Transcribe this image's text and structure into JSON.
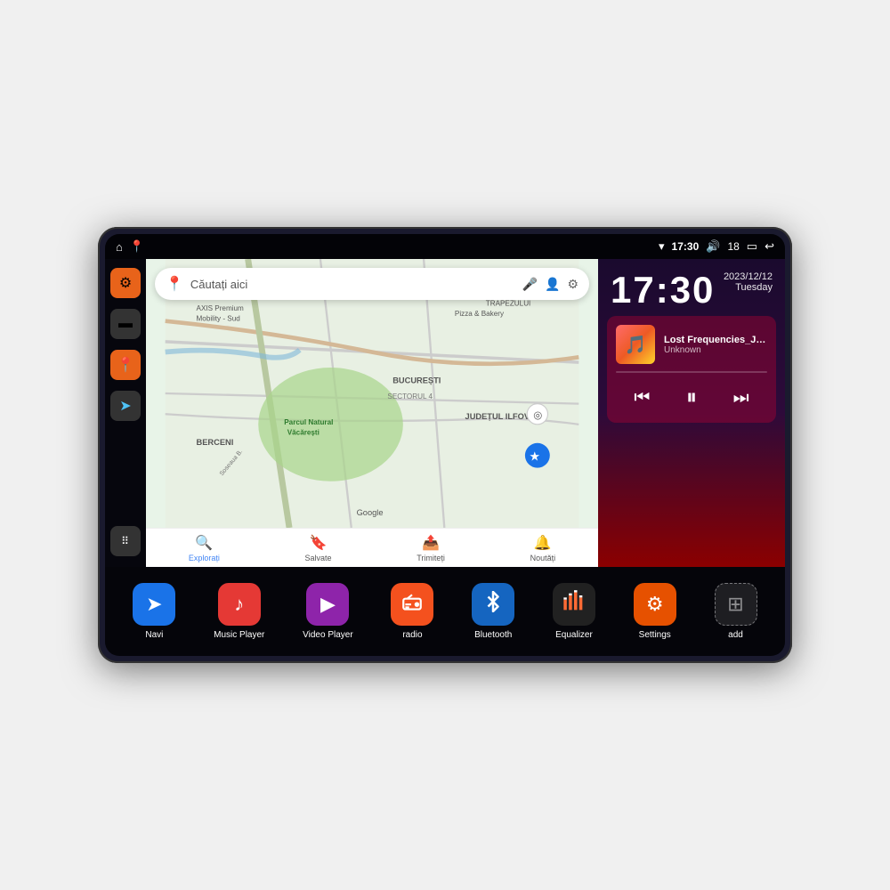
{
  "device": {
    "status_bar": {
      "wifi_icon": "▾",
      "time": "17:30",
      "volume_icon": "🔊",
      "battery_number": "18",
      "battery_icon": "🔋",
      "back_icon": "↩",
      "home_icon": "⌂",
      "maps_icon": "📍"
    },
    "left_sidebar": {
      "items": [
        {
          "id": "settings",
          "icon": "⚙",
          "style": "orange"
        },
        {
          "id": "files",
          "icon": "📁",
          "style": "dark"
        },
        {
          "id": "location",
          "icon": "📍",
          "style": "orange"
        },
        {
          "id": "navigation",
          "icon": "➤",
          "style": "dark"
        },
        {
          "id": "apps",
          "icon": "⋮⋮⋮",
          "style": "grid"
        }
      ]
    },
    "map": {
      "search_placeholder": "Căutați aici",
      "bottom_items": [
        {
          "id": "explore",
          "label": "Explorați",
          "icon": "🔍",
          "active": true
        },
        {
          "id": "saved",
          "label": "Salvate",
          "icon": "🔖",
          "active": false
        },
        {
          "id": "contribute",
          "label": "Trimiteți",
          "icon": "📤",
          "active": false
        },
        {
          "id": "news",
          "label": "Noutăți",
          "icon": "🔔",
          "active": false
        }
      ],
      "locations": [
        "AXIS Premium Mobility - Sud",
        "Parcul Natural Văcărești",
        "Pizza & Bakery",
        "BUCUREȘTI",
        "SECTORUL 4",
        "BERCENI",
        "JUDEȚUL ILFOV",
        "TRAPEZULUI"
      ]
    },
    "clock": {
      "time": "17:30",
      "date": "2023/12/12",
      "day": "Tuesday"
    },
    "music_player": {
      "title": "Lost Frequencies_Janie...",
      "artist": "Unknown",
      "album_art_emoji": "🎵"
    },
    "apps": [
      {
        "id": "navi",
        "label": "Navi",
        "icon": "➤",
        "color": "blue"
      },
      {
        "id": "music-player",
        "label": "Music Player",
        "icon": "♪",
        "color": "red"
      },
      {
        "id": "video-player",
        "label": "Video Player",
        "icon": "▶",
        "color": "purple"
      },
      {
        "id": "radio",
        "label": "radio",
        "icon": "📻",
        "color": "orange-red"
      },
      {
        "id": "bluetooth",
        "label": "Bluetooth",
        "icon": "⚡",
        "color": "blue-bt"
      },
      {
        "id": "equalizer",
        "label": "Equalizer",
        "icon": "≡",
        "color": "dark-eq"
      },
      {
        "id": "settings",
        "label": "Settings",
        "icon": "⚙",
        "color": "orange-set"
      },
      {
        "id": "add",
        "label": "add",
        "icon": "+",
        "color": "gray-add"
      }
    ]
  }
}
